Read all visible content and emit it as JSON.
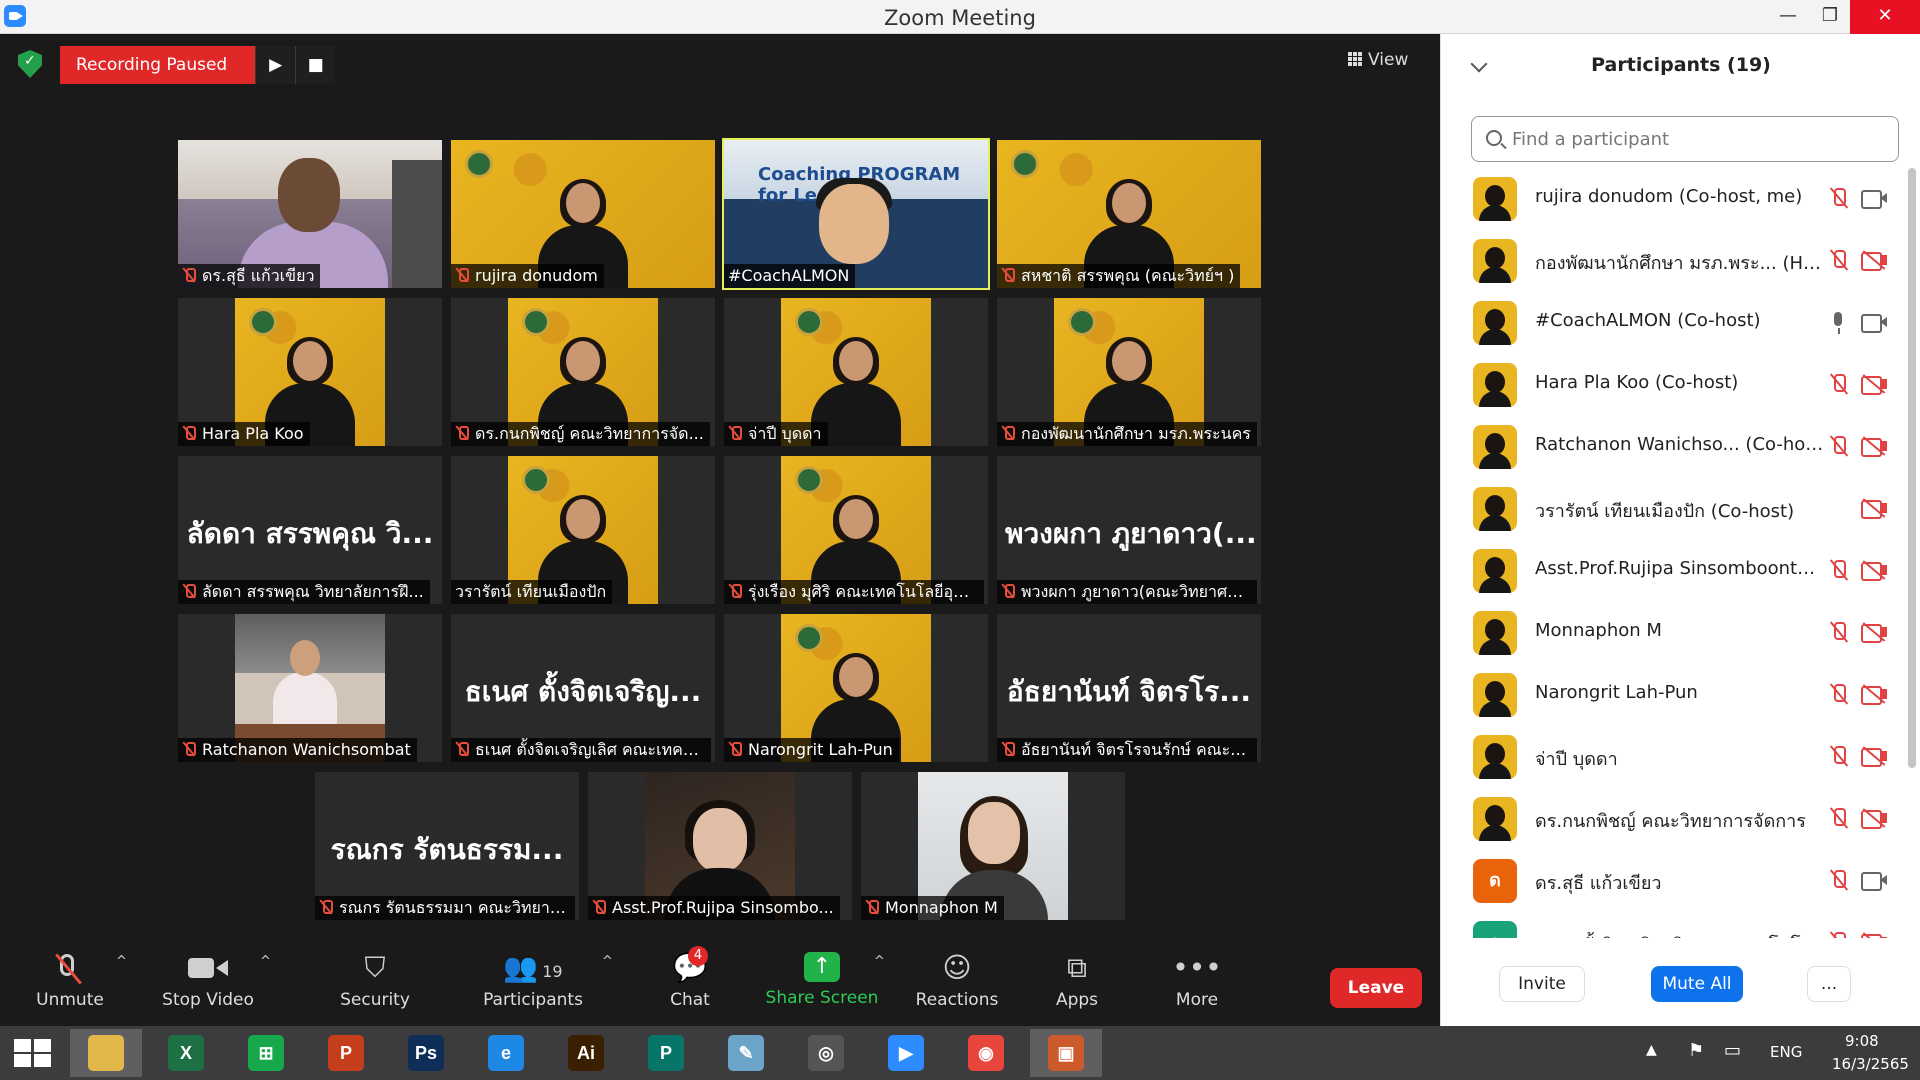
{
  "window": {
    "title": "Zoom Meeting"
  },
  "recording": {
    "label": "Recording Paused",
    "play": "▶",
    "stop": "■"
  },
  "view": {
    "label": "View"
  },
  "tiles": [
    {
      "name": "ดร.สุธี  แก้วเขียว",
      "style": "office",
      "active": false
    },
    {
      "name": "rujira donudom",
      "style": "yellow",
      "active": false
    },
    {
      "name": "#CoachALMON",
      "style": "coach",
      "coach_text": "Coaching PROGRAM for Lecturer",
      "active": true
    },
    {
      "name": "สหชาติ สรรพคุณ (คณะวิทย์ฯ )",
      "style": "yellow",
      "active": false
    },
    {
      "name": "Hara Pla Koo",
      "style": "yellow-center",
      "active": false
    },
    {
      "name": "ดร.กนกพิชญ์ คณะวิทยาการจัด...",
      "style": "yellow-center",
      "active": false
    },
    {
      "name": "จ่าปี บุดดา",
      "style": "yellow-center",
      "active": false
    },
    {
      "name": "กองพัฒนานักศึกษา มรภ.พระนคร",
      "style": "yellow-center",
      "active": false
    },
    {
      "name": "ลัดดา สรรพคุณ วิทยาลัยการฝึ...",
      "style": "text",
      "big": "ลัดดา สรรพคุณ วิ...",
      "active": false
    },
    {
      "name": "วรารัตน์ เทียนเมืองปัก",
      "style": "yellow-center",
      "active": false
    },
    {
      "name": "รุ่งเรือง มุศิริ คณะเทคโนโลยีอุตส...",
      "style": "yellow-center",
      "active": false
    },
    {
      "name": "พวงผกา ภูยาดาว(คณะวิทยาศา...",
      "style": "text",
      "big": "พวงผกา ภูยาดาว(...",
      "active": false
    },
    {
      "name": "Ratchanon Wanichsombat",
      "style": "restaurant",
      "active": false
    },
    {
      "name": "ธเนศ ตั้งจิตเจริญเลิศ คณะเทคโน...",
      "style": "text",
      "big": "ธเนศ ตั้งจิตเจริญ...",
      "active": false
    },
    {
      "name": "Narongrit Lah-Pun",
      "style": "yellow-center",
      "active": false
    },
    {
      "name": "อัธยานันท์ จิตรโรจนรักษ์ คณะเท...",
      "style": "text",
      "big": "อัธยานันท์ จิตรโร...",
      "active": false
    },
    {
      "name": "รณกร รัตนธรรมมา คณะวิทยาศ...",
      "style": "text",
      "big": "รณกร รัตนธรรม...",
      "active": false
    },
    {
      "name": "Asst.Prof.Rujipa Sinsombo...",
      "style": "dark",
      "active": false
    },
    {
      "name": "Monnaphon M",
      "style": "light",
      "active": false
    }
  ],
  "toolbar": {
    "unmute": "Unmute",
    "stop_video": "Stop Video",
    "security": "Security",
    "participants": "Participants",
    "participants_count": "19",
    "chat": "Chat",
    "chat_badge": "4",
    "share_screen": "Share Screen",
    "reactions": "Reactions",
    "apps": "Apps",
    "more": "More",
    "leave": "Leave"
  },
  "panel": {
    "title": "Participants (19)",
    "search_placeholder": "Find a participant",
    "invite": "Invite",
    "mute_all": "Mute All",
    "more": "...",
    "participants": [
      {
        "name": "rujira donudom (Co-host, me)",
        "mic": "muted",
        "cam": "on",
        "avatar": "photo"
      },
      {
        "name": "กองพัฒนานักศึกษา มรภ.พระ...  (Host)",
        "mic": "muted",
        "cam": "off",
        "avatar": "photo"
      },
      {
        "name": "#CoachALMON (Co-host)",
        "mic": "on",
        "cam": "on",
        "avatar": "photo"
      },
      {
        "name": "Hara Pla Koo (Co-host)",
        "mic": "muted",
        "cam": "off",
        "avatar": "photo"
      },
      {
        "name": "Ratchanon Wanichso...  (Co-host)",
        "mic": "muted",
        "cam": "off",
        "avatar": "photo"
      },
      {
        "name": "วรารัตน์ เทียนเมืองปัก (Co-host)",
        "mic": "none",
        "cam": "off",
        "avatar": "photo"
      },
      {
        "name": "Asst.Prof.Rujipa Sinsomboonth...",
        "mic": "muted",
        "cam": "off",
        "avatar": "photo"
      },
      {
        "name": "Monnaphon M",
        "mic": "muted",
        "cam": "off",
        "avatar": "photo"
      },
      {
        "name": "Narongrit Lah-Pun",
        "mic": "muted",
        "cam": "off",
        "avatar": "photo"
      },
      {
        "name": "จ่าปี บุดดา",
        "mic": "muted",
        "cam": "off",
        "avatar": "photo"
      },
      {
        "name": "ดร.กนกพิชญ์ คณะวิทยาการจัดการ",
        "mic": "muted",
        "cam": "off",
        "avatar": "photo"
      },
      {
        "name": "ดร.สุธี  แก้วเขียว",
        "mic": "muted",
        "cam": "on",
        "avatar": "letter",
        "letter": "ด",
        "color": "#e8630a"
      },
      {
        "name": "ธเนศ ตั้งจิตเจริญเลิศ คณะเทคโนโลยีอุ...",
        "mic": "muted",
        "cam": "off",
        "avatar": "letter",
        "letter": "ธ",
        "color": "#1aa37a"
      }
    ]
  },
  "taskbar": {
    "apps": [
      {
        "icon": "file-explorer-icon",
        "glyph": "",
        "color": "#e2b84a",
        "active": true
      },
      {
        "icon": "excel-icon",
        "glyph": "X",
        "color": "#1d7044",
        "active": false
      },
      {
        "icon": "store-icon",
        "glyph": "⊞",
        "color": "#18a84c",
        "active": false
      },
      {
        "icon": "powerpoint-icon",
        "glyph": "P",
        "color": "#c43e1c",
        "active": false
      },
      {
        "icon": "photoshop-icon",
        "glyph": "Ps",
        "color": "#0f2e57",
        "active": false
      },
      {
        "icon": "internet-explorer-icon",
        "glyph": "e",
        "color": "#1e88e5",
        "active": false
      },
      {
        "icon": "illustrator-icon",
        "glyph": "Ai",
        "color": "#3a1f00",
        "active": false
      },
      {
        "icon": "publisher-icon",
        "glyph": "P",
        "color": "#077568",
        "active": false
      },
      {
        "icon": "paint-icon",
        "glyph": "✎",
        "color": "#6aa4c9",
        "active": false
      },
      {
        "icon": "photoscape-icon",
        "glyph": "◎",
        "color": "#555555",
        "active": false
      },
      {
        "icon": "zoom-icon",
        "glyph": "▶",
        "color": "#2d8cff",
        "active": false
      },
      {
        "icon": "chrome-icon",
        "glyph": "◉",
        "color": "#e8453c",
        "active": false
      },
      {
        "icon": "photos-icon",
        "glyph": "▣",
        "color": "#cc5a2a",
        "active": true
      }
    ],
    "language": "ENG",
    "time": "9:08",
    "date": "16/3/2565"
  },
  "colors": {
    "accent": "#0e72ed",
    "leave": "#e02828",
    "share": "#21b24a",
    "active_speaker": "#e4f05a"
  }
}
